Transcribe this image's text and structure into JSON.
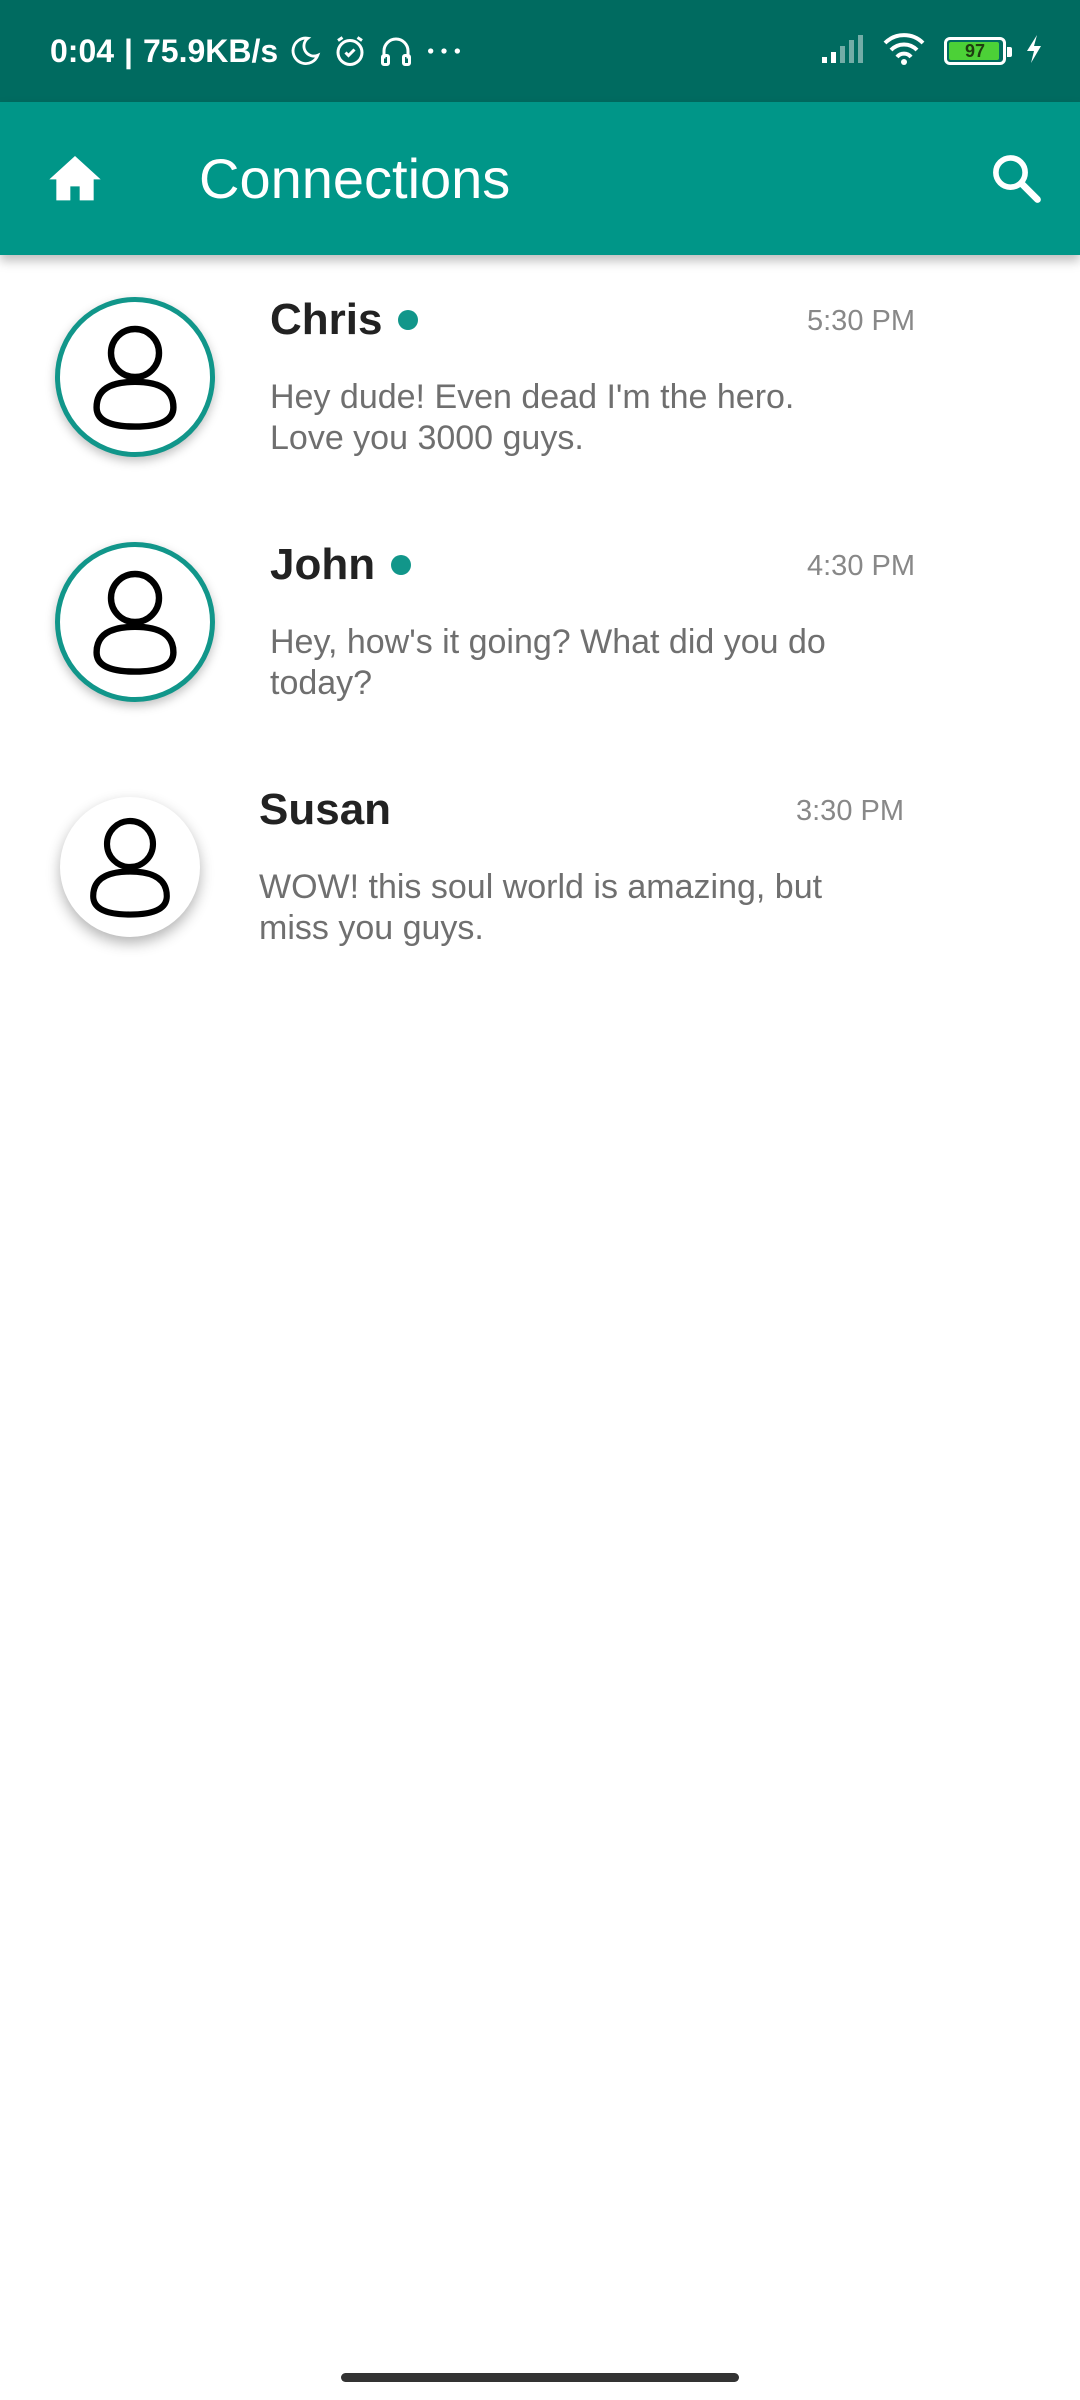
{
  "status_bar": {
    "time": "0:04",
    "speed": "75.9KB/s",
    "battery_percent": "97",
    "battery_level": 0.97,
    "icons": [
      "moon-icon",
      "alarm-icon",
      "headset-icon",
      "more-dots-icon",
      "signal-icon",
      "wifi-icon",
      "battery-icon",
      "charging-icon"
    ]
  },
  "app_bar": {
    "title": "Connections",
    "home_icon": "home-icon",
    "search_icon": "search-icon",
    "color": "#009688"
  },
  "conversations": [
    {
      "name": "Chris",
      "online": true,
      "time": "5:30 PM",
      "preview": "Hey dude! Even dead I'm the hero. Love you 3000 guys."
    },
    {
      "name": "John",
      "online": true,
      "time": "4:30 PM",
      "preview": "Hey, how's it going? What did you do today?"
    },
    {
      "name": "Susan",
      "online": false,
      "time": "3:30 PM",
      "preview": "WOW! this soul world is amazing, but miss you guys."
    }
  ],
  "colors": {
    "status_bar": "#006b60",
    "accent": "#11968a"
  }
}
